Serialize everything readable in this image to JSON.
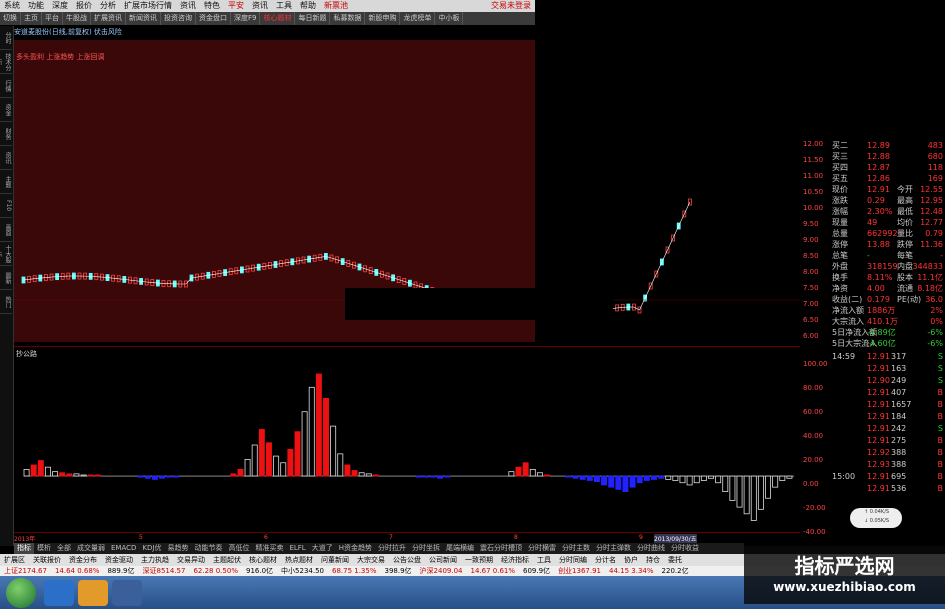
{
  "menu": {
    "items": [
      "系统",
      "功能",
      "深度",
      "报价",
      "分析",
      "扩展市场行情",
      "资讯",
      "特色",
      "平安",
      "资讯",
      "工具",
      "帮助"
    ],
    "highlight_index": 8,
    "extra": "新票池",
    "right": "交易未登录"
  },
  "toolbar": {
    "items": [
      "切换",
      "主页",
      "平台",
      "牛股战",
      "扩展资讯",
      "新闻资讯",
      "投资咨询",
      "资金盘口",
      "深度F9",
      "核心题材",
      "每日新题",
      "私募数据",
      "新股申购",
      "龙虎榜单",
      "中小板"
    ],
    "active_index": 9
  },
  "subtitle": "安道麦股份(日线,前复权) 伏击风险",
  "left_strip": [
    "分时",
    "技术分析",
    "行情",
    "资金",
    "财务",
    "资讯",
    "主题",
    "F10",
    "画面",
    "十大股东",
    "最新",
    "热门"
  ],
  "legend": "多头盈利 上涨趋势 上涨回调",
  "price_axis": [
    "12.00",
    "11.50",
    "11.00",
    "10.50",
    "10.00",
    "9.50",
    "9.00",
    "8.50",
    "8.00",
    "7.50",
    "7.00",
    "6.50",
    "6.00"
  ],
  "lower_label": "抄公路",
  "lower_axis": [
    "100.00",
    "80.00",
    "60.00",
    "40.00",
    "20.00",
    "0.00",
    "-20.00",
    "-40.00"
  ],
  "quote": {
    "rows": [
      {
        "l": "买二",
        "v": "12.89",
        "v3": "483"
      },
      {
        "l": "买三",
        "v": "12.88",
        "v3": "680"
      },
      {
        "l": "买四",
        "v": "12.87",
        "v3": "118"
      },
      {
        "l": "买五",
        "v": "12.86",
        "v3": "169"
      },
      {
        "l": "现价",
        "v": "12.91",
        "l2": "今开",
        "v2": "12.55"
      },
      {
        "l": "涨跌",
        "v": "0.29",
        "l2": "最高",
        "v2": "12.95"
      },
      {
        "l": "涨幅",
        "v": "2.30%",
        "l2": "最低",
        "v2": "12.48"
      },
      {
        "l": "现量",
        "v": "49",
        "l2": "均价",
        "v2": "12.77"
      },
      {
        "l": "总量",
        "v": "662992",
        "l2": "量比",
        "v2": "0.79"
      },
      {
        "l": "涨停",
        "v": "13.88",
        "l2": "跌停",
        "v2": "11.36"
      },
      {
        "l": "总笔",
        "v": "-",
        "l2": "每笔",
        "v2": "-"
      },
      {
        "l": "外盘",
        "v": "318159",
        "l2": "内盘",
        "v2": "344833"
      },
      {
        "l": "换手",
        "v": "8.11%",
        "l2": "股本",
        "v2": "11.1亿"
      },
      {
        "l": "净资",
        "v": "4.00",
        "l2": "流通",
        "v2": "8.18亿"
      },
      {
        "l": "收益(二)",
        "v": "0.179",
        "l2": "PE(动)",
        "v2": "36.0"
      },
      {
        "l": "净流入额",
        "v": "1886万",
        "v3": "2%"
      },
      {
        "l": "大宗流入",
        "v": "410.1万",
        "v3": "0%"
      },
      {
        "l": "5日净流入额",
        "v": "-4.89亿",
        "v3": "-6%"
      },
      {
        "l": "5日大宗流入",
        "v": "-4.60亿",
        "v3": "-6%"
      }
    ],
    "ticks": [
      {
        "t": "14:59",
        "p": "12.91",
        "n": "317",
        "s": "S"
      },
      {
        "t": "",
        "p": "12.91",
        "n": "163",
        "s": "S"
      },
      {
        "t": "",
        "p": "12.90",
        "n": "249",
        "s": "S"
      },
      {
        "t": "",
        "p": "12.91",
        "n": "407",
        "s": "B"
      },
      {
        "t": "",
        "p": "12.91",
        "n": "1657",
        "s": "B"
      },
      {
        "t": "",
        "p": "12.91",
        "n": "184",
        "s": "B"
      },
      {
        "t": "",
        "p": "12.91",
        "n": "242",
        "s": "S"
      },
      {
        "t": "",
        "p": "12.91",
        "n": "275",
        "s": "B"
      },
      {
        "t": "",
        "p": "12.92",
        "n": "388",
        "s": "B"
      },
      {
        "t": "",
        "p": "12.93",
        "n": "388",
        "s": "B"
      },
      {
        "t": "15:00",
        "p": "12.91",
        "n": "695",
        "s": "B"
      },
      {
        "t": "",
        "p": "12.91",
        "n": "536",
        "s": "B"
      }
    ]
  },
  "date_axis": [
    "2013年",
    "5",
    "6",
    "7",
    "8",
    "9",
    "2013/09/30/五"
  ],
  "tabs": [
    "指标",
    "模析",
    "全部",
    "成交量弱",
    "EMACD",
    "KDJ优",
    "易趋势",
    "动能节奏",
    "高低位",
    "精准买卖",
    "ELFL",
    "大道了",
    "H资金趋势",
    "分时拉升",
    "分时坐拆",
    "尾端横编",
    "震石分时槽顶",
    "分时横雷",
    "分时主数",
    "分时主弹数",
    "分时曲线",
    "分时收益"
  ],
  "tabs_active": 0,
  "ticker": [
    {
      "text": "扩展区",
      "up": false
    },
    {
      "text": "关联报价",
      "up": false
    },
    {
      "text": "资金分布",
      "up": false
    },
    {
      "text": "资金驱动",
      "up": false
    },
    {
      "text": "主力执趋",
      "up": false
    },
    {
      "text": "交易异动",
      "up": false
    },
    {
      "text": "主题起伏",
      "up": false
    },
    {
      "text": "核心题材",
      "up": false
    },
    {
      "text": "热点题材",
      "up": false
    },
    {
      "text": "问董新闻",
      "up": false
    },
    {
      "text": "大宗交易",
      "up": false
    },
    {
      "text": "公告公盘",
      "up": false
    },
    {
      "text": "公司新闻",
      "up": false
    },
    {
      "text": "一致预期",
      "up": false
    },
    {
      "text": "经济指标",
      "up": false
    },
    {
      "text": "工具",
      "up": false
    },
    {
      "text": "分时同编",
      "up": false
    },
    {
      "text": "分计名",
      "up": false
    },
    {
      "text": "协户",
      "up": false
    },
    {
      "text": "持仓",
      "up": false
    },
    {
      "text": "委托",
      "up": false
    }
  ],
  "ticker2": [
    {
      "text": "上证2174.67",
      "up": true
    },
    {
      "text": "14.64 0.68%",
      "up": true
    },
    {
      "text": "889.9亿",
      "up": false
    },
    {
      "text": "深证8514.57",
      "up": true
    },
    {
      "text": "62.28 0.50%",
      "up": true
    },
    {
      "text": "916.0亿",
      "up": false
    },
    {
      "text": "中小5234.50",
      "up": false
    },
    {
      "text": "68.75 1.35%",
      "up": true
    },
    {
      "text": "398.9亿",
      "up": false
    },
    {
      "text": "沪深2409.04",
      "up": true
    },
    {
      "text": "14.67 0.61%",
      "up": true
    },
    {
      "text": "609.9亿",
      "up": false
    },
    {
      "text": "创业1367.91",
      "up": true
    },
    {
      "text": "44.15 3.34%",
      "up": true
    },
    {
      "text": "220.2亿",
      "up": false
    }
  ],
  "bubble": [
    "↑ 0.04K/S",
    "↓ 0.05K/S"
  ],
  "watermark": {
    "title": "指标严选网",
    "url": "www.xuezhibiao.com"
  },
  "chart_data": {
    "type": "bar",
    "title": "抄公路",
    "xlabel": "",
    "ylabel": "",
    "ylim": [
      -45,
      110
    ],
    "series": [
      {
        "name": "",
        "values": [
          6,
          10,
          14,
          8,
          4,
          3,
          2,
          2,
          1,
          1,
          1,
          0,
          0,
          0,
          0,
          0,
          -1,
          -2,
          -3,
          -2,
          -1,
          -1,
          0,
          0,
          0,
          0,
          0,
          0,
          0,
          2,
          6,
          15,
          28,
          42,
          30,
          18,
          12,
          24,
          40,
          58,
          80,
          92,
          70,
          45,
          20,
          10,
          5,
          3,
          2,
          1,
          0,
          0,
          0,
          0,
          0,
          -1,
          -1,
          -1,
          -2,
          -1,
          0,
          0,
          0,
          0,
          0,
          0,
          0,
          0,
          4,
          8,
          12,
          6,
          3,
          1,
          0,
          0,
          -1,
          -2,
          -3,
          -4,
          -5,
          -8,
          -10,
          -12,
          -14,
          -10,
          -6,
          -4,
          -3,
          -2,
          -3,
          -4,
          -6,
          -8,
          -6,
          -4,
          -2,
          -6,
          -14,
          -22,
          -28,
          -34,
          -40,
          -30,
          -20,
          -10,
          -4,
          -2
        ]
      }
    ]
  }
}
